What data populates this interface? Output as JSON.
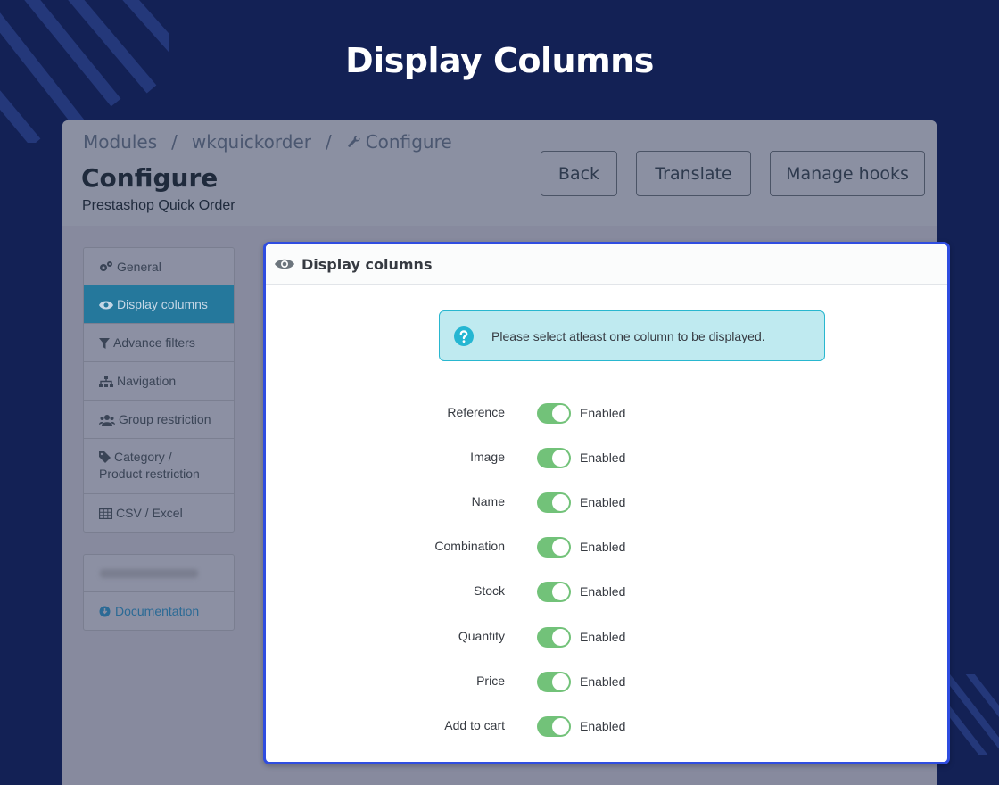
{
  "hero": {
    "title": "Display Columns"
  },
  "breadcrumb": {
    "items": [
      "Modules",
      "wkquickorder",
      "Configure"
    ],
    "separator": "/"
  },
  "page": {
    "title": "Configure",
    "subtitle": "Prestashop Quick Order"
  },
  "header_buttons": {
    "back": "Back",
    "translate": "Translate",
    "manage_hooks": "Manage hooks"
  },
  "sidebar": {
    "items": [
      {
        "label": "General",
        "icon": "gears-icon"
      },
      {
        "label": "Display columns",
        "icon": "eye-icon",
        "active": true
      },
      {
        "label": "Advance filters",
        "icon": "filter-icon"
      },
      {
        "label": "Navigation",
        "icon": "sitemap-icon"
      },
      {
        "label": "Group restriction",
        "icon": "users-icon"
      },
      {
        "label": "Category /",
        "label2": "Product restriction",
        "icon": "tag-icon"
      },
      {
        "label": "CSV / Excel",
        "icon": "table-icon"
      }
    ],
    "documentation": "Documentation"
  },
  "card": {
    "title": "Display columns",
    "alert": "Please select atleast one column to be displayed.",
    "rows": [
      {
        "label": "Reference",
        "state": "Enabled"
      },
      {
        "label": "Image",
        "state": "Enabled"
      },
      {
        "label": "Name",
        "state": "Enabled"
      },
      {
        "label": "Combination",
        "state": "Enabled"
      },
      {
        "label": "Stock",
        "state": "Enabled"
      },
      {
        "label": "Quantity",
        "state": "Enabled"
      },
      {
        "label": "Price",
        "state": "Enabled"
      },
      {
        "label": "Add to cart",
        "state": "Enabled"
      }
    ]
  },
  "colors": {
    "background": "#132155",
    "accent_border": "#2f4de0",
    "toggle_on": "#72c279",
    "active_sidebar": "#25789c",
    "alert_bg": "#bfeaf0"
  }
}
